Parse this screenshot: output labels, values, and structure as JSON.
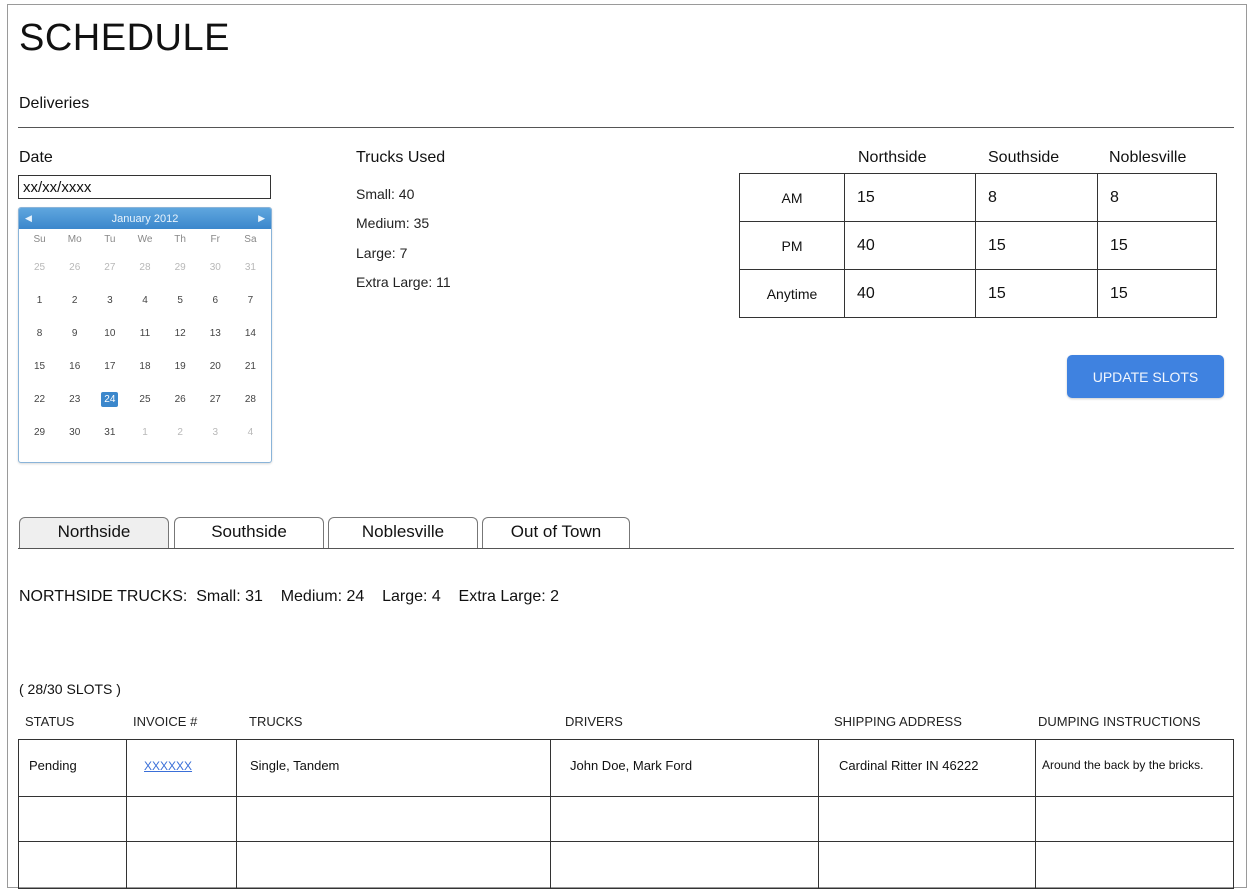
{
  "page": {
    "title": "SCHEDULE",
    "subtitle": "Deliveries"
  },
  "date": {
    "label": "Date",
    "value": "xx/xx/xxxx"
  },
  "calendar": {
    "month_label": "January 2012",
    "prev_icon": "chevron-left-icon",
    "next_icon": "chevron-right-icon",
    "weekdays": [
      "Su",
      "Mo",
      "Tu",
      "We",
      "Th",
      "Fr",
      "Sa"
    ],
    "days": [
      {
        "n": "25",
        "other": true
      },
      {
        "n": "26",
        "other": true
      },
      {
        "n": "27",
        "other": true
      },
      {
        "n": "28",
        "other": true
      },
      {
        "n": "29",
        "other": true
      },
      {
        "n": "30",
        "other": true
      },
      {
        "n": "31",
        "other": true
      },
      {
        "n": "1"
      },
      {
        "n": "2"
      },
      {
        "n": "3"
      },
      {
        "n": "4"
      },
      {
        "n": "5"
      },
      {
        "n": "6"
      },
      {
        "n": "7"
      },
      {
        "n": "8"
      },
      {
        "n": "9"
      },
      {
        "n": "10"
      },
      {
        "n": "11"
      },
      {
        "n": "12"
      },
      {
        "n": "13"
      },
      {
        "n": "14"
      },
      {
        "n": "15"
      },
      {
        "n": "16"
      },
      {
        "n": "17"
      },
      {
        "n": "18"
      },
      {
        "n": "19"
      },
      {
        "n": "20"
      },
      {
        "n": "21"
      },
      {
        "n": "22"
      },
      {
        "n": "23"
      },
      {
        "n": "24",
        "selected": true
      },
      {
        "n": "25"
      },
      {
        "n": "26"
      },
      {
        "n": "27"
      },
      {
        "n": "28"
      },
      {
        "n": "29"
      },
      {
        "n": "30"
      },
      {
        "n": "31"
      },
      {
        "n": "1",
        "other": true
      },
      {
        "n": "2",
        "other": true
      },
      {
        "n": "3",
        "other": true
      },
      {
        "n": "4",
        "other": true
      }
    ]
  },
  "trucks_used": {
    "title": "Trucks Used",
    "lines": [
      "Small: 40",
      "Medium: 35",
      "Large: 7",
      "Extra Large: 11"
    ]
  },
  "slots": {
    "columns": [
      "Northside",
      "Southside",
      "Noblesville"
    ],
    "rows": [
      {
        "label": "AM",
        "values": [
          "15",
          "8",
          "8"
        ]
      },
      {
        "label": "PM",
        "values": [
          "40",
          "15",
          "15"
        ]
      },
      {
        "label": "Anytime",
        "values": [
          "40",
          "15",
          "15"
        ]
      }
    ],
    "update_button": "UPDATE SLOTS"
  },
  "tabs": [
    {
      "label": "Northside",
      "active": true
    },
    {
      "label": "Southside"
    },
    {
      "label": "Noblesville"
    },
    {
      "label": "Out of Town"
    }
  ],
  "northside": {
    "summary": "NORTHSIDE TRUCKS:  Small: 31    Medium: 24    Large: 4    Extra Large: 2",
    "slot_count": "( 28/30 SLOTS )"
  },
  "deliveries": {
    "columns": [
      "STATUS",
      "INVOICE #",
      "TRUCKS",
      "DRIVERS",
      "SHIPPING ADDRESS",
      "DUMPING INSTRUCTIONS"
    ],
    "rows": [
      {
        "status": "Pending",
        "invoice": "XXXXXX",
        "trucks": "Single, Tandem",
        "drivers": "John Doe, Mark Ford",
        "address": "Cardinal Ritter IN 46222",
        "instructions": "Around the back by the bricks."
      }
    ]
  }
}
